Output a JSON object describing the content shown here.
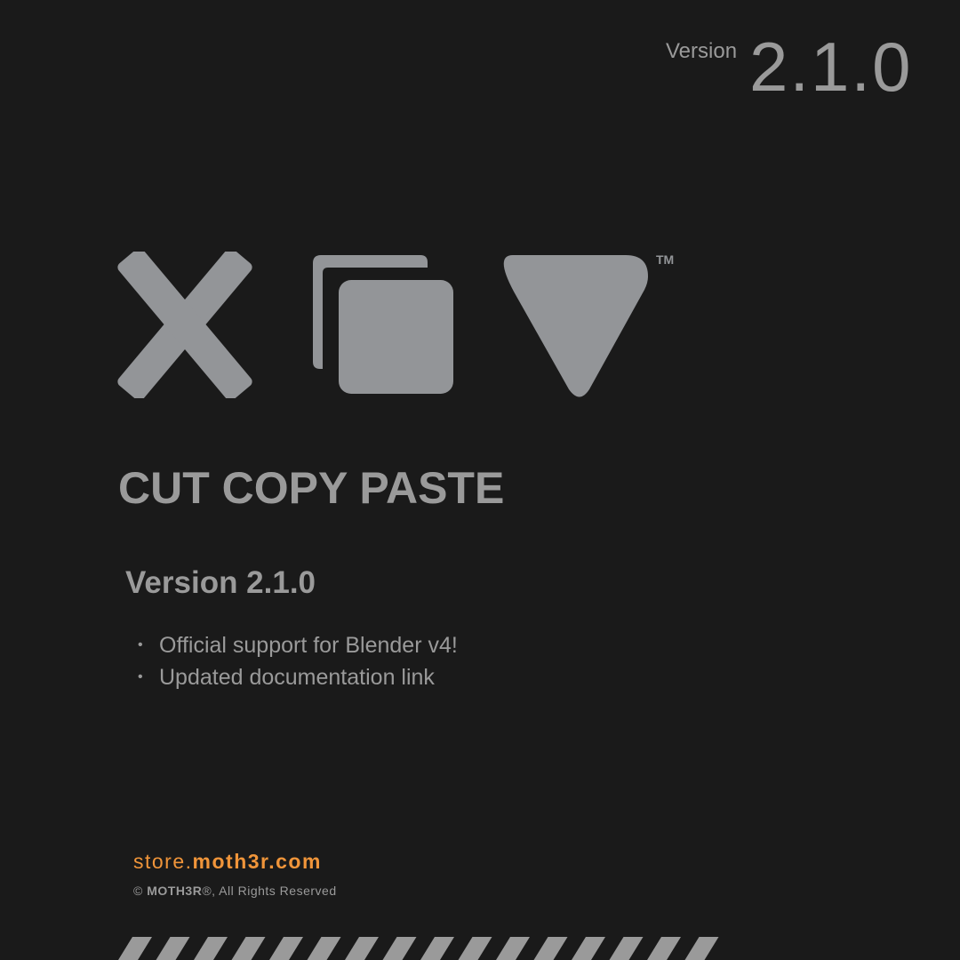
{
  "header": {
    "version_label": "Version",
    "version_number": "2.1.0"
  },
  "logo": {
    "icons": [
      "cut-x-icon",
      "copy-icon",
      "paste-triangle-icon"
    ],
    "trademark": "TM",
    "color": "#939598"
  },
  "product_name": "CUT COPY PASTE",
  "changelog": {
    "title": "Version 2.1.0",
    "items": [
      "Official support for Blender v4!",
      "Updated documentation link"
    ]
  },
  "footer": {
    "store_prefix": "store.",
    "store_domain": "moth3r.com",
    "copyright_symbol": "©",
    "brand": "MOTH3R",
    "rights": "®, All Rights Reserved",
    "accent_color": "#f0953a"
  }
}
